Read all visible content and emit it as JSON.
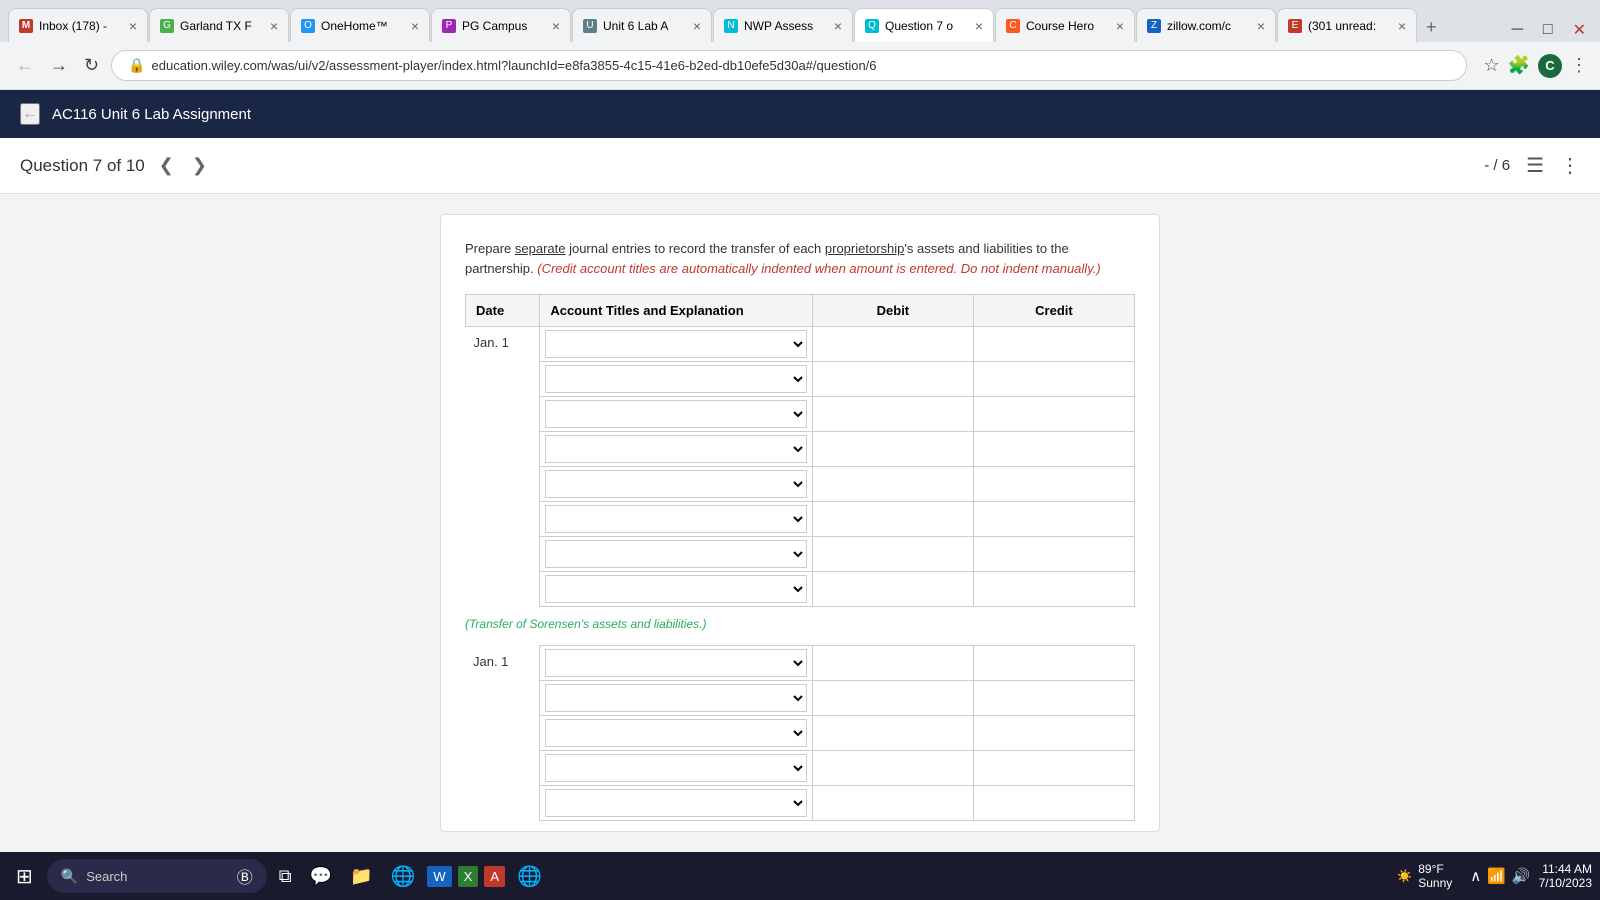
{
  "browser": {
    "tabs": [
      {
        "id": "tab1",
        "favicon": "M",
        "title": "Inbox (178) -",
        "active": false
      },
      {
        "id": "tab2",
        "favicon": "G",
        "title": "Garland TX F",
        "active": false
      },
      {
        "id": "tab3",
        "favicon": "O",
        "title": "OneHome™",
        "active": false
      },
      {
        "id": "tab4",
        "favicon": "P",
        "title": "PG Campus",
        "active": false
      },
      {
        "id": "tab5",
        "favicon": "U",
        "title": "Unit 6 Lab A",
        "active": false
      },
      {
        "id": "tab6",
        "favicon": "N",
        "title": "NWP Assess",
        "active": false
      },
      {
        "id": "tab7",
        "favicon": "Q",
        "title": "Question 7 o",
        "active": true
      },
      {
        "id": "tab8",
        "favicon": "C",
        "title": "Course Hero",
        "active": false
      },
      {
        "id": "tab9",
        "favicon": "Z",
        "title": "zillow.com/c",
        "active": false
      },
      {
        "id": "tab10",
        "favicon": "E",
        "title": "(301 unread:",
        "active": false
      }
    ],
    "address": "education.wiley.com/was/ui/v2/assessment-player/index.html?launchId=e8fa3855-4c15-41e6-b2ed-db10efe5d30a#/question/6"
  },
  "app_header": {
    "back_icon": "←",
    "title": "AC116 Unit 6 Lab Assignment"
  },
  "question_nav": {
    "label": "Question 7 of 10",
    "prev_icon": "❮",
    "next_icon": "❯",
    "score": "- / 6",
    "list_icon": "☰",
    "more_icon": "⋮"
  },
  "instruction": {
    "text1": "Prepare ",
    "separate": "separate",
    "text2": " journal entries to record the transfer of each proprietorship's assets and liabilities to the partnership. ",
    "red_note": "(Credit account titles are automatically indented when amount is entered. Do not indent manually.)"
  },
  "table": {
    "headers": [
      "Date",
      "Account Titles and Explanation",
      "Debit",
      "Credit"
    ],
    "section1_date": "Jan. 1",
    "section2_date": "Jan. 1",
    "note1": "(Transfer of Sorensen's assets and liabilities.)",
    "rows_count1": 8,
    "rows_count2": 5
  },
  "taskbar": {
    "start_icon": "⊞",
    "search_placeholder": "Search",
    "search_icon": "🔍",
    "weather": "89°F",
    "weather_condition": "Sunny",
    "time": "11:44 AM",
    "date": "7/10/2023",
    "icons": [
      "💬",
      "📁",
      "🌐",
      "W",
      "X",
      "A",
      "🌐"
    ]
  }
}
